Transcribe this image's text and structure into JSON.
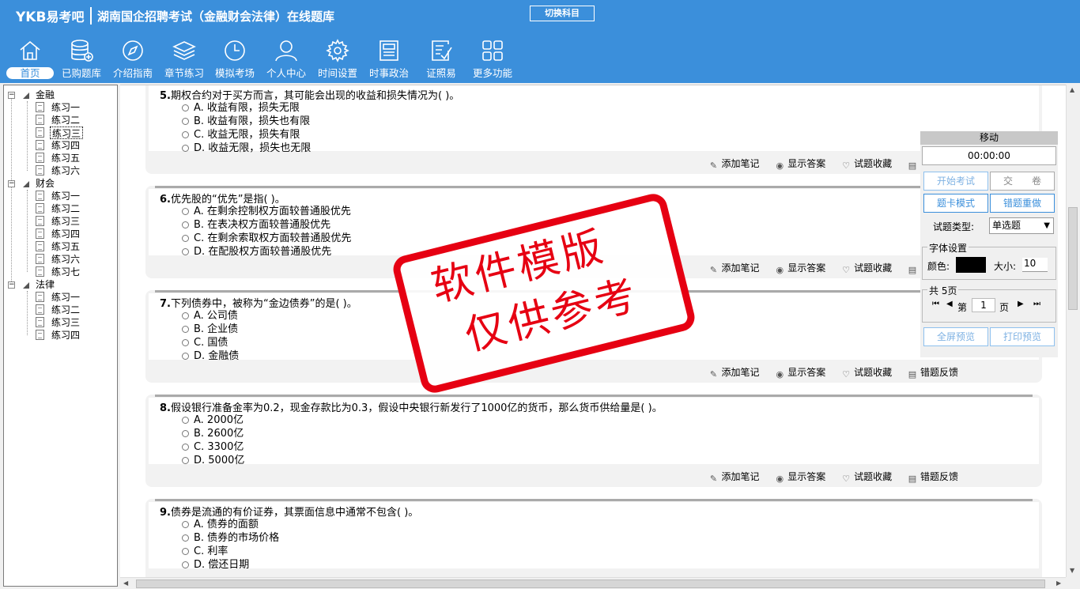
{
  "header": {
    "logo_latin": "YKB",
    "logo_cn": "易考吧",
    "title": "湖南国企招聘考试（金融财会法律）在线题库",
    "switch_label": "切换科目"
  },
  "nav": [
    {
      "label": "首页",
      "icon": "home-icon"
    },
    {
      "label": "已购题库",
      "icon": "database-icon"
    },
    {
      "label": "介绍指南",
      "icon": "compass-icon"
    },
    {
      "label": "章节练习",
      "icon": "layers-icon"
    },
    {
      "label": "模拟考场",
      "icon": "clock-icon"
    },
    {
      "label": "个人中心",
      "icon": "user-icon"
    },
    {
      "label": "时间设置",
      "icon": "gear-icon"
    },
    {
      "label": "时事政治",
      "icon": "news-icon"
    },
    {
      "label": "证照易",
      "icon": "checklist-icon"
    },
    {
      "label": "更多功能",
      "icon": "grid-icon"
    }
  ],
  "tree": {
    "groups": [
      {
        "label": "金融",
        "items": [
          "练习一",
          "练习二",
          "练习三",
          "练习四",
          "练习五",
          "练习六"
        ]
      },
      {
        "label": "财会",
        "items": [
          "练习一",
          "练习二",
          "练习三",
          "练习四",
          "练习五",
          "练习六",
          "练习七"
        ]
      },
      {
        "label": "法律",
        "items": [
          "练习一",
          "练习二",
          "练习三",
          "练习四"
        ]
      }
    ]
  },
  "questions": [
    {
      "num": "5.",
      "text": "期权合约对于买方而言，其可能会出现的收益和损失情况为( )。",
      "options": [
        "A. 收益有限，损失无限",
        "B. 收益有限，损失也有限",
        "C. 收益无限，损失有限",
        "D. 收益无限，损失也无限"
      ]
    },
    {
      "num": "6.",
      "text": "优先股的“优先”是指( )。",
      "options": [
        "A. 在剩余控制权方面较普通股优先",
        "B. 在表决权方面较普通股优先",
        "C. 在剩余索取权方面较普通股优先",
        "D. 在配股权方面较普通股优先"
      ]
    },
    {
      "num": "7.",
      "text": "下列债券中，被称为“金边债券”的是( )。",
      "options": [
        "A. 公司债",
        "B. 企业债",
        "C. 国债",
        "D. 金融债"
      ]
    },
    {
      "num": "8.",
      "text": "假设银行准备金率为0.2，现金存款比为0.3，假设中央银行新发行了1000亿的货币，那么货币供给量是( )。",
      "options": [
        "A. 2000亿",
        "B. 2600亿",
        "C. 3300亿",
        "D. 5000亿"
      ]
    },
    {
      "num": "9.",
      "text": "债券是流通的有价证券，其票面信息中通常不包含( )。",
      "options": [
        "A. 债券的面额",
        "B. 债券的市场价格",
        "C. 利率",
        "D. 偿还日期"
      ]
    }
  ],
  "actions": {
    "note": "添加笔记",
    "answer": "显示答案",
    "fav": "试题收藏",
    "feedback": "错题反馈"
  },
  "panel": {
    "move": "移动",
    "timer": "00:00:00",
    "start": "开始考试",
    "submit": "交　　卷",
    "card": "题卡模式",
    "redo": "错题重做",
    "type_label": "试题类型:",
    "type_value": "单选题",
    "font_group": "字体设置",
    "color_label": "颜色:",
    "color_value": "#000000",
    "size_label": "大小:",
    "size_value": "10",
    "pages_group": "共 5页",
    "page_prefix": "第",
    "page_value": "1",
    "page_suffix": "页",
    "fullscreen": "全屏预览",
    "print": "打印预览"
  },
  "watermark": {
    "line1": "软件模版",
    "line2": "仅供参考"
  },
  "colors": {
    "header": "#3b8fdb",
    "watermark": "#e60012"
  }
}
